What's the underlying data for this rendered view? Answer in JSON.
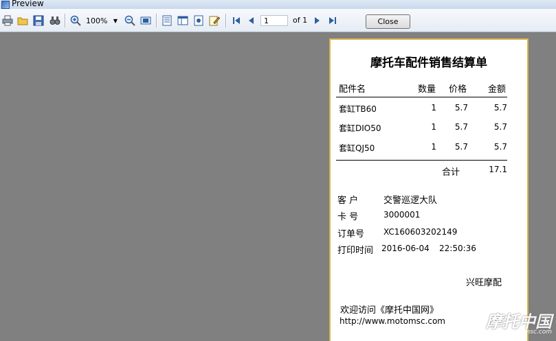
{
  "window": {
    "title": "Preview"
  },
  "toolbar": {
    "zoom": "100%",
    "page_current": "1",
    "page_of": "of 1",
    "close_label": "Close"
  },
  "receipt": {
    "title": "摩托车配件销售结算单",
    "headers": {
      "name": "配件名",
      "qty": "数量",
      "price": "价格",
      "amount": "金额"
    },
    "rows": [
      {
        "name": "套缸TB60",
        "qty": "1",
        "price": "5.7",
        "amount": "5.7"
      },
      {
        "name": "套缸DIO50",
        "qty": "1",
        "price": "5.7",
        "amount": "5.7"
      },
      {
        "name": "套缸QJ50",
        "qty": "1",
        "price": "5.7",
        "amount": "5.7"
      }
    ],
    "total_label": "合计",
    "total_value": "17.1",
    "customer_label": "客 户",
    "customer_value": "交警巡逻大队",
    "card_label": "卡 号",
    "card_value": "3000001",
    "order_label": "订单号",
    "order_value": "XC160603202149",
    "print_time_label": "打印时间",
    "print_date": "2016-06-04",
    "print_time": "22:50:36",
    "shop_name": "兴旺摩配",
    "welcome": "欢迎访问《摩托中国网》",
    "url": "http://www.motomsc.com"
  },
  "watermark": {
    "text": "摩托中国",
    "sub": "motomsc.com"
  }
}
